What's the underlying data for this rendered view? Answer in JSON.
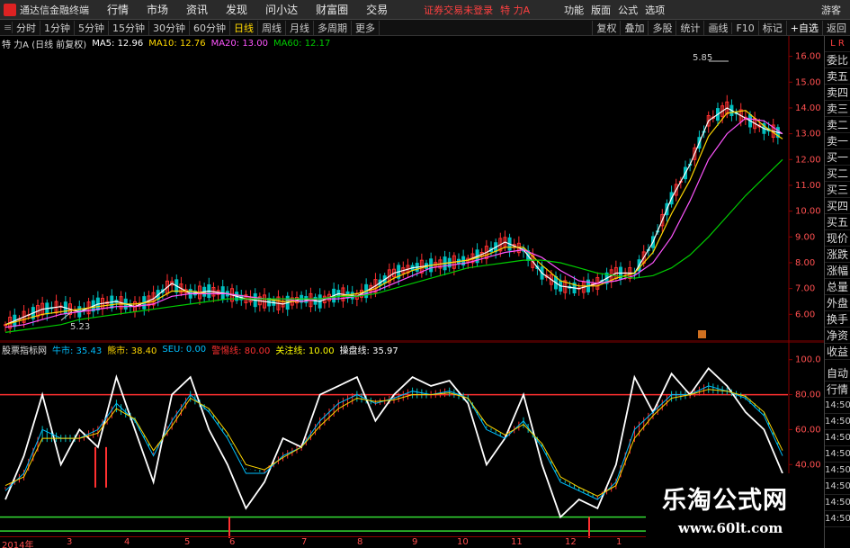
{
  "titlebar": {
    "app_title": "通达信金融终端",
    "menus": [
      "行情",
      "市场",
      "资讯",
      "发现",
      "问小达",
      "财富圈",
      "交易"
    ],
    "login_status": "证券交易未登录",
    "stock_title": "特 力A",
    "right_menus": [
      "功能",
      "版面",
      "公式",
      "选项"
    ],
    "guest": "游客"
  },
  "periodbar": {
    "periods": [
      "分时",
      "1分钟",
      "5分钟",
      "15分钟",
      "30分钟",
      "60分钟",
      "日线",
      "周线",
      "月线",
      "多周期",
      "更多"
    ],
    "active": "日线",
    "tools": [
      "复权",
      "叠加",
      "多股",
      "统计",
      "画线",
      "F10",
      "标记",
      "+自选",
      "返回"
    ]
  },
  "main_info": {
    "stock": "特 力A (日线 前复权)",
    "ma5": "MA5: 12.96",
    "ma10": "MA10: 12.76",
    "ma20": "MA20: 13.00",
    "ma60": "MA60: 12.17",
    "colors": {
      "ma5": "#ffffff",
      "ma10": "#ffd700",
      "ma20": "#ff55ff",
      "ma60": "#00cc00"
    }
  },
  "sub_info": {
    "name": "股票指标网",
    "bull": "牛市: 35.43",
    "bear": "熊市: 38.40",
    "seu": "SEU: 0.00",
    "alert": "警惕线: 80.00",
    "watch": "关注线: 10.00",
    "op": "操盘线: 35.97",
    "colors": {
      "bull": "#00bfff",
      "bear": "#ffd700",
      "seu": "#00bfff",
      "alert": "#ff3030",
      "watch": "#ffff00",
      "op": "#ffffff"
    }
  },
  "price_axis": [
    "16.00",
    "15.00",
    "14.00",
    "13.00",
    "12.00",
    "11.00",
    "10.00",
    "9.00",
    "8.00",
    "7.00",
    "6.00"
  ],
  "ind_axis": [
    "100.0",
    "80.00",
    "60.00",
    "40.00"
  ],
  "annotations": {
    "high": "5.85",
    "low": "5.23"
  },
  "xaxis_labels": [
    "2014年",
    "3",
    "4",
    "5",
    "6",
    "7",
    "8",
    "9",
    "10",
    "11",
    "12",
    "1",
    "2"
  ],
  "side_panel": [
    "委比",
    "卖五",
    "卖四",
    "卖三",
    "卖二",
    "卖一",
    "买一",
    "买二",
    "买三",
    "买四",
    "买五",
    "现价",
    "涨跌",
    "涨幅",
    "总量",
    "外盘",
    "换手",
    "净资",
    "收益"
  ],
  "side_panel_lower": [
    "自动",
    "行情",
    "14:50",
    "14:50",
    "14:50",
    "14:50",
    "14:50",
    "14:50",
    "14:50",
    "14:50"
  ],
  "watermark": {
    "title": "乐淘公式网",
    "url": "www.60lt.com"
  },
  "chart_data": [
    {
      "type": "line",
      "title": "特 力A (日线 前复权)",
      "ylim": [
        5,
        16.3
      ],
      "series": [
        {
          "name": "MA5",
          "values": [
            5.6,
            5.9,
            6.2,
            6.3,
            6.1,
            6.4,
            6.5,
            6.3,
            6.6,
            7.2,
            6.8,
            6.9,
            6.8,
            6.6,
            6.5,
            6.4,
            6.6,
            6.5,
            6.8,
            6.7,
            7.1,
            7.6,
            7.8,
            7.9,
            8.0,
            8.1,
            8.4,
            8.8,
            8.5,
            7.6,
            7.1,
            7.0,
            7.2,
            7.6,
            7.6,
            8.8,
            10.5,
            11.8,
            13.5,
            14.0,
            13.6,
            13.2,
            13.0
          ]
        },
        {
          "name": "MA10",
          "values": [
            5.6,
            5.8,
            6.0,
            6.1,
            6.2,
            6.3,
            6.4,
            6.4,
            6.5,
            6.9,
            6.9,
            6.8,
            6.8,
            6.7,
            6.6,
            6.5,
            6.5,
            6.6,
            6.7,
            6.8,
            7.0,
            7.4,
            7.7,
            7.9,
            8.0,
            8.1,
            8.3,
            8.6,
            8.6,
            7.9,
            7.3,
            7.1,
            7.1,
            7.4,
            7.6,
            8.4,
            9.9,
            11.2,
            12.9,
            13.8,
            13.9,
            13.3,
            12.8
          ]
        },
        {
          "name": "MA20",
          "values": [
            5.5,
            5.6,
            5.8,
            6.0,
            6.1,
            6.2,
            6.3,
            6.3,
            6.4,
            6.7,
            6.8,
            6.8,
            6.8,
            6.7,
            6.6,
            6.6,
            6.5,
            6.6,
            6.6,
            6.7,
            6.9,
            7.2,
            7.5,
            7.8,
            7.9,
            8.0,
            8.2,
            8.4,
            8.5,
            8.2,
            7.7,
            7.3,
            7.2,
            7.3,
            7.5,
            8.0,
            9.0,
            10.4,
            12.0,
            13.0,
            13.6,
            13.5,
            13.0
          ]
        },
        {
          "name": "MA60",
          "values": [
            5.3,
            5.4,
            5.5,
            5.6,
            5.8,
            5.9,
            6.0,
            6.1,
            6.2,
            6.3,
            6.4,
            6.5,
            6.6,
            6.6,
            6.6,
            6.6,
            6.6,
            6.6,
            6.7,
            6.7,
            6.8,
            7.0,
            7.2,
            7.4,
            7.6,
            7.8,
            7.9,
            8.0,
            8.1,
            8.1,
            8.0,
            7.8,
            7.6,
            7.5,
            7.4,
            7.5,
            7.8,
            8.3,
            9.0,
            9.8,
            10.6,
            11.3,
            12.0
          ]
        }
      ]
    },
    {
      "type": "line",
      "title": "股票指标网",
      "ylim": [
        0,
        105
      ],
      "series": [
        {
          "name": "操盘线",
          "values": [
            20,
            45,
            80,
            40,
            60,
            50,
            90,
            60,
            30,
            80,
            90,
            60,
            40,
            15,
            30,
            55,
            50,
            80,
            85,
            90,
            65,
            80,
            90,
            85,
            88,
            75,
            40,
            55,
            80,
            40,
            10,
            20,
            15,
            40,
            90,
            70,
            92,
            80,
            95,
            85,
            70,
            60,
            35
          ]
        },
        {
          "name": "牛市",
          "values": [
            25,
            35,
            60,
            55,
            55,
            60,
            75,
            65,
            45,
            65,
            80,
            70,
            55,
            35,
            35,
            45,
            50,
            65,
            75,
            80,
            75,
            78,
            82,
            80,
            82,
            78,
            60,
            55,
            65,
            50,
            30,
            25,
            20,
            30,
            60,
            70,
            80,
            80,
            85,
            82,
            78,
            68,
            45
          ]
        },
        {
          "name": "熊市",
          "values": [
            28,
            33,
            55,
            55,
            55,
            58,
            72,
            66,
            48,
            62,
            78,
            72,
            58,
            40,
            37,
            44,
            50,
            62,
            72,
            78,
            76,
            77,
            80,
            80,
            81,
            78,
            63,
            57,
            63,
            52,
            33,
            27,
            22,
            28,
            55,
            68,
            78,
            80,
            83,
            82,
            79,
            70,
            48
          ]
        }
      ]
    }
  ]
}
